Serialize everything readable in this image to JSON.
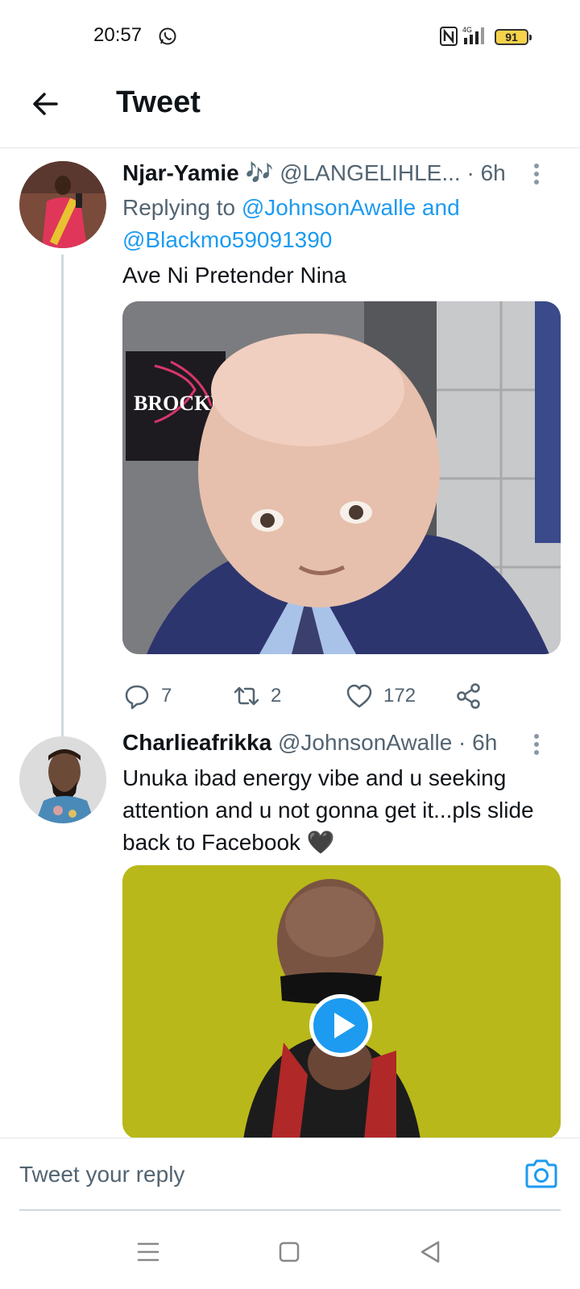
{
  "status_bar": {
    "time": "20:57",
    "battery": "91",
    "network": "4G"
  },
  "header": {
    "title": "Tweet"
  },
  "tweets": [
    {
      "name": "Njar-Yamie",
      "emoji": "🎶",
      "handle": "@LANGELIHLE...",
      "time": "· 6h",
      "replying_prefix": "Replying to",
      "mentions": [
        "@JohnsonAwalle",
        "@Blackmo59091390"
      ],
      "and_word": "and",
      "text": "Ave Ni Pretender Nina",
      "media_sign": "BROCKL",
      "stats": {
        "replies": "7",
        "retweets": "2",
        "likes": "172"
      }
    },
    {
      "name": "Charlieafrikka",
      "handle": "@JohnsonAwalle",
      "time": "· 6h",
      "text": "Unuka ibad energy vibe and u seeking attention and u not gonna get it...pls slide back to Facebook",
      "emoji": "🖤"
    }
  ],
  "reply": {
    "placeholder": "Tweet your reply"
  },
  "colors": {
    "accent": "#1d9bf0",
    "muted": "#536471",
    "text": "#0f1419"
  },
  "icons": [
    "back-arrow-icon",
    "more-icon",
    "reply-icon",
    "retweet-icon",
    "like-icon",
    "share-icon",
    "camera-icon",
    "play-icon",
    "menu-icon",
    "home-icon",
    "back-triangle-icon"
  ]
}
